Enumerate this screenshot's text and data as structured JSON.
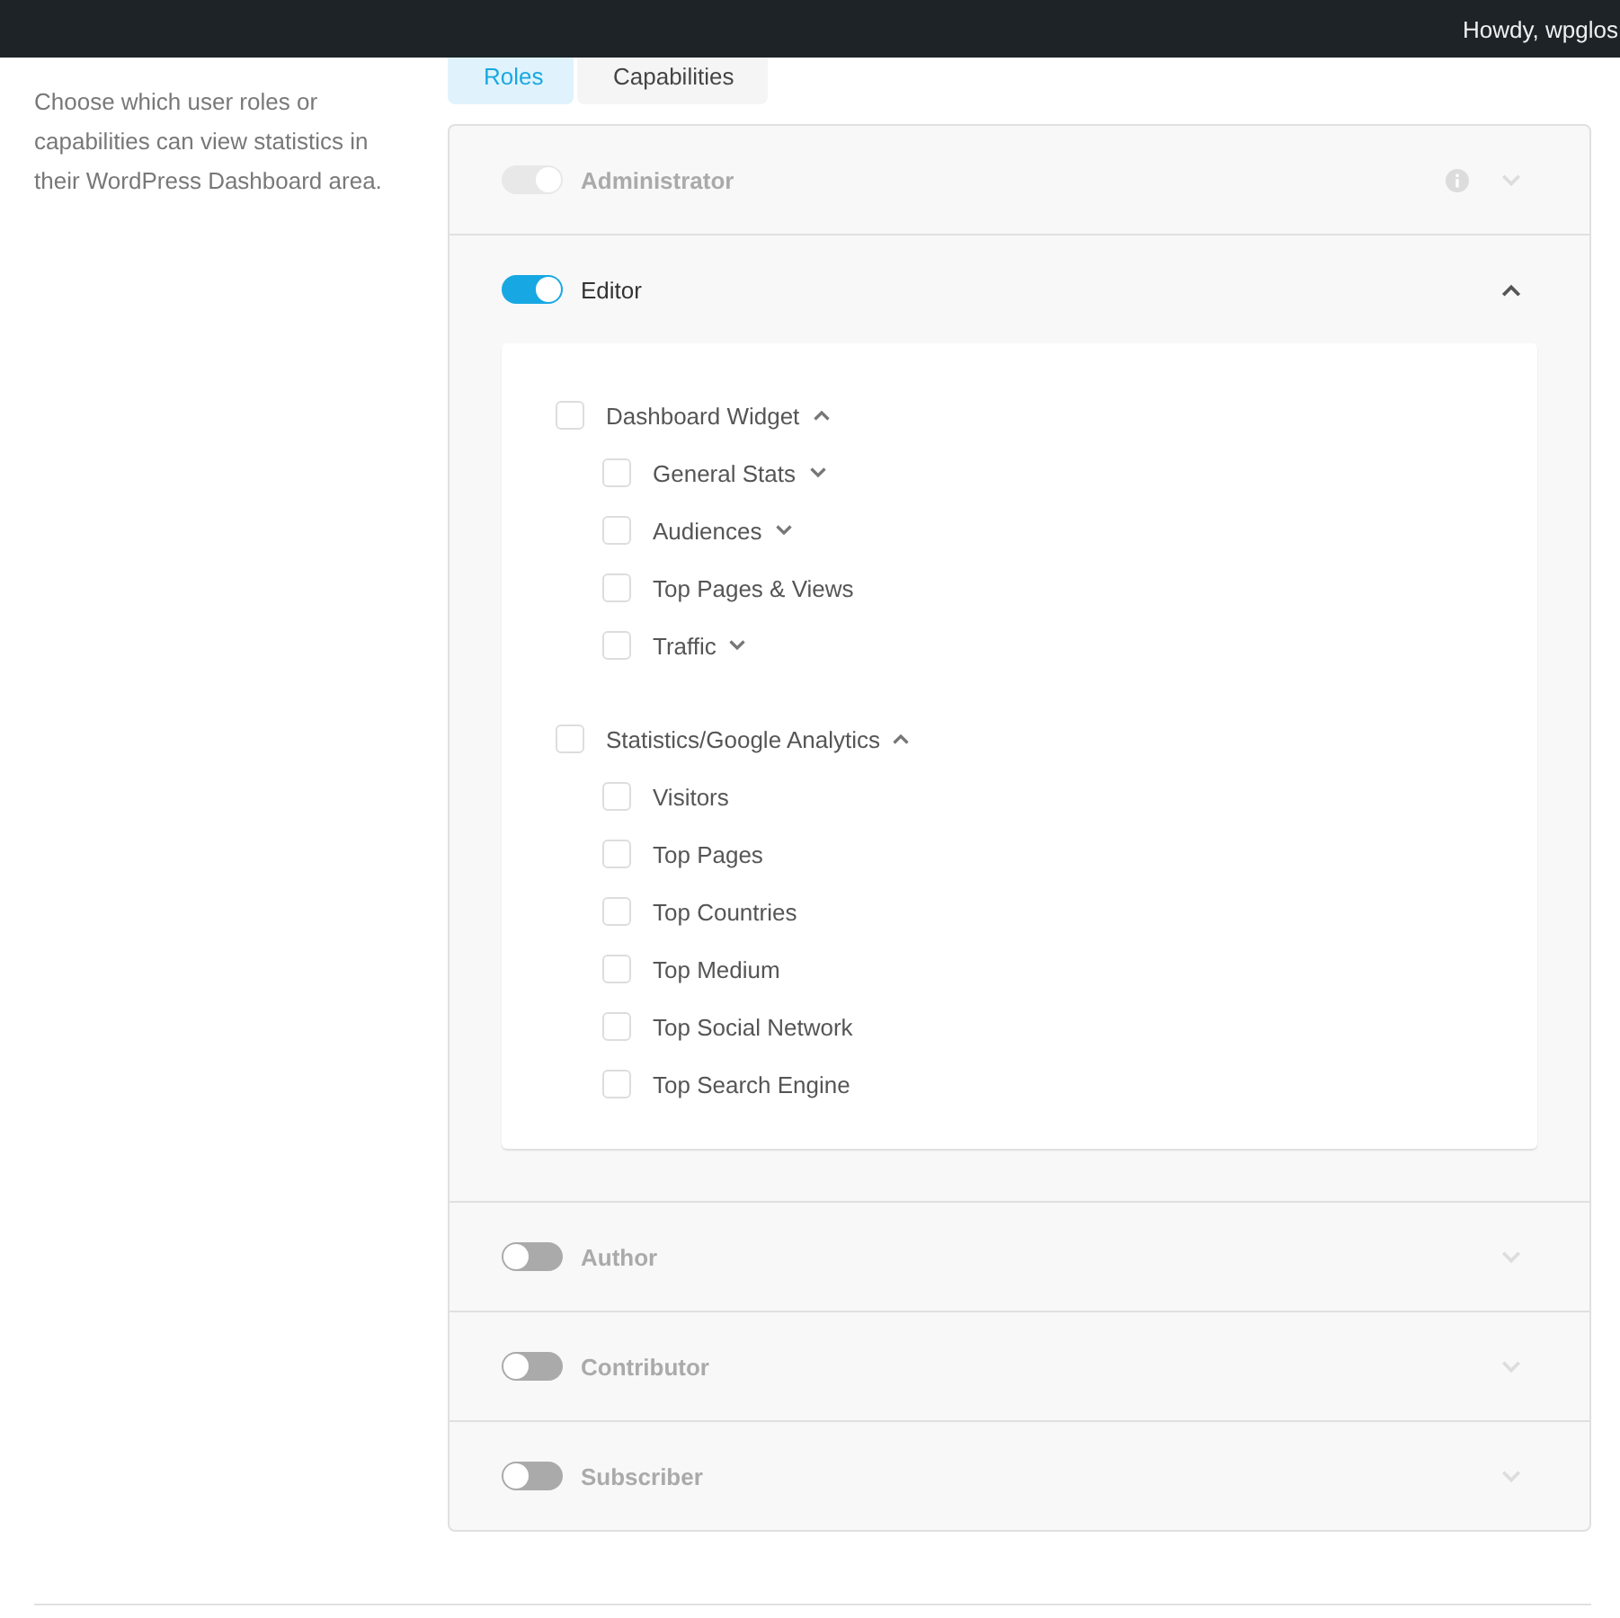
{
  "admin_bar": {
    "greeting": "Howdy, wpglos"
  },
  "intro": {
    "description": "Choose which user roles or capabilities can view statistics in their WordPress Dashboard area."
  },
  "tabs": [
    {
      "label": "Roles",
      "selected": true
    },
    {
      "label": "Capabilities",
      "selected": false
    }
  ],
  "roles": [
    {
      "name": "Administrator",
      "on": true,
      "disabled": true,
      "info": true,
      "expanded": false
    },
    {
      "name": "Editor",
      "on": true,
      "disabled": false,
      "expanded": true,
      "groups": [
        {
          "label": "Dashboard Widget",
          "checked": false,
          "expanded": true,
          "children": [
            {
              "label": "General Stats",
              "checked": false,
              "expanded": false
            },
            {
              "label": "Audiences",
              "checked": false,
              "expanded": false
            },
            {
              "label": "Top Pages & Views",
              "checked": false
            },
            {
              "label": "Traffic",
              "checked": false,
              "expanded": false
            }
          ]
        },
        {
          "label": "Statistics/Google Analytics",
          "checked": false,
          "expanded": true,
          "children": [
            {
              "label": "Visitors",
              "checked": false
            },
            {
              "label": "Top Pages",
              "checked": false
            },
            {
              "label": "Top Countries",
              "checked": false
            },
            {
              "label": "Top Medium",
              "checked": false
            },
            {
              "label": "Top Social Network",
              "checked": false
            },
            {
              "label": "Top Search Engine",
              "checked": false
            }
          ]
        }
      ]
    },
    {
      "name": "Author",
      "on": false,
      "disabled": false,
      "expanded": false
    },
    {
      "name": "Contributor",
      "on": false,
      "disabled": false,
      "expanded": false
    },
    {
      "name": "Subscriber",
      "on": false,
      "disabled": false,
      "expanded": false
    }
  ]
}
